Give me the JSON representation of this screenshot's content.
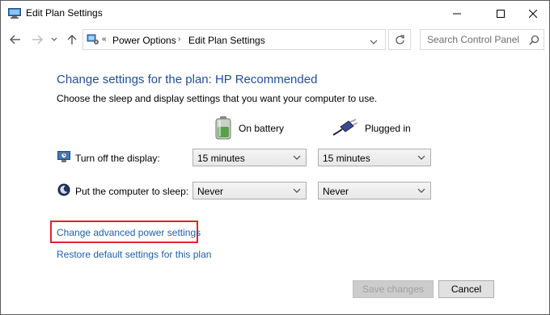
{
  "window": {
    "title": "Edit Plan Settings"
  },
  "nav": {
    "breadcrumb_sep": "«",
    "crumbs": [
      "Power Options",
      "Edit Plan Settings"
    ],
    "search_placeholder": "Search Control Panel"
  },
  "content": {
    "heading": "Change settings for the plan: HP Recommended",
    "subtext": "Choose the sleep and display settings that you want your computer to use.",
    "columns": {
      "battery_label": "On battery",
      "plugged_label": "Plugged in"
    },
    "rows": [
      {
        "label": "Turn off the display:",
        "battery_value": "15 minutes",
        "plugged_value": "15 minutes"
      },
      {
        "label": "Put the computer to sleep:",
        "battery_value": "Never",
        "plugged_value": "Never"
      }
    ],
    "links": {
      "advanced": "Change advanced power settings",
      "restore": "Restore default settings for this plan"
    }
  },
  "buttons": {
    "save": "Save changes",
    "cancel": "Cancel"
  },
  "colors": {
    "heading": "#1f4e99",
    "link": "#1f5fa8",
    "highlight": "#e0242c"
  }
}
